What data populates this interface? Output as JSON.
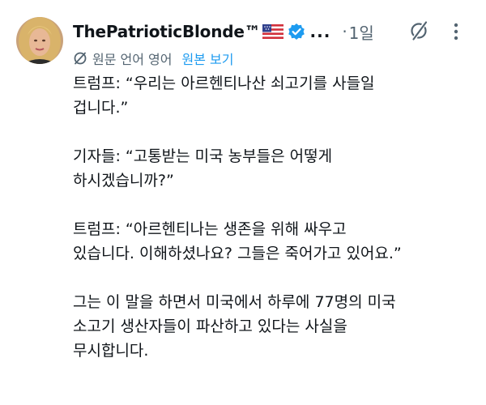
{
  "post": {
    "author": {
      "display_name": "ThePatrioticBlonde™",
      "avatar_icon": "avatar",
      "flag_icon": "us-flag-icon",
      "verified_icon": "verified-badge-icon",
      "verified_color": "#1d9bf0"
    },
    "header": {
      "ellipsis": "...",
      "separator": "·",
      "timestamp": "1일",
      "grok_icon": "grok-icon",
      "more_icon": "more-options-icon"
    },
    "translation": {
      "icon": "translate-icon",
      "label": "원문 언어 영어",
      "show_original": "원본 보기",
      "link_color": "#1d9bf0"
    },
    "paragraphs": [
      {
        "lines": [
          "트럼프: “우리는 아르헨티나산 쇠고기를 사들일",
          "겁니다.”"
        ]
      },
      {
        "lines": [
          "기자들: “고통받는 미국 농부들은 어떻게",
          "하시겠습니까?”"
        ]
      },
      {
        "lines": [
          "트럼프: “아르헨티나는 생존을 위해 싸우고",
          "있습니다. 이해하셨나요? 그들은 죽어가고 있어요.”"
        ]
      },
      {
        "lines": [
          "그는 이 말을 하면서 미국에서 하루에 77명의 미국",
          "소고기 생산자들이 파산하고 있다는 사실을",
          "무시합니다."
        ]
      }
    ]
  }
}
